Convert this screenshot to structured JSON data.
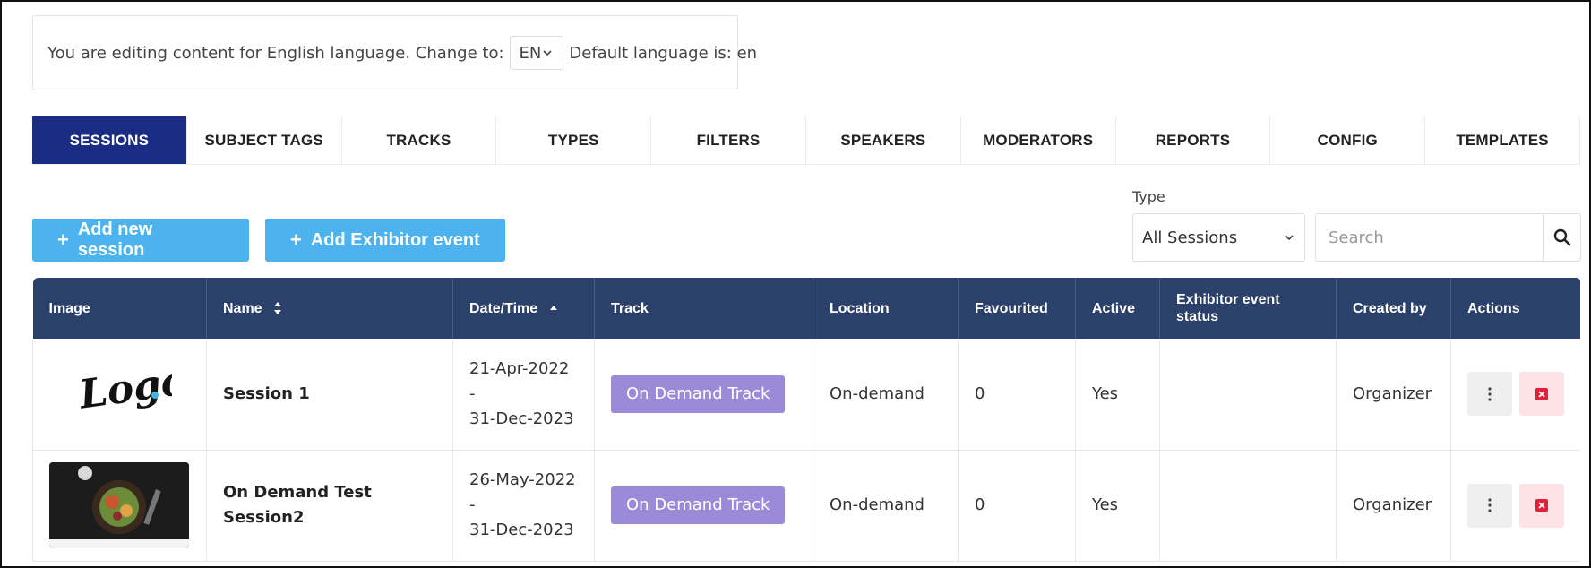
{
  "language_bar": {
    "text_before": "You are editing content for English language. Change to:",
    "selected": "EN",
    "text_after": "Default language is: en"
  },
  "tabs": [
    {
      "label": "SESSIONS",
      "active": true
    },
    {
      "label": "SUBJECT TAGS",
      "active": false
    },
    {
      "label": "TRACKS",
      "active": false
    },
    {
      "label": "TYPES",
      "active": false
    },
    {
      "label": "FILTERS",
      "active": false
    },
    {
      "label": "SPEAKERS",
      "active": false
    },
    {
      "label": "MODERATORS",
      "active": false
    },
    {
      "label": "REPORTS",
      "active": false
    },
    {
      "label": "CONFIG",
      "active": false
    },
    {
      "label": "TEMPLATES",
      "active": false
    }
  ],
  "toolbar": {
    "add_session": "Add new session",
    "add_exhibitor": "Add Exhibitor event",
    "type_label": "Type",
    "type_selected": "All Sessions",
    "search_placeholder": "Search"
  },
  "table": {
    "headers": [
      "Image",
      "Name",
      "Date/Time",
      "Track",
      "Location",
      "Favourited",
      "Active",
      "Exhibitor event status",
      "Created by",
      "Actions"
    ],
    "rows": [
      {
        "image": "logo-image",
        "name": "Session 1",
        "date_start": "21-Apr-2022 -",
        "date_end": "31-Dec-2023",
        "track": "On Demand Track",
        "location": "On-demand",
        "favourited": "0",
        "active": "Yes",
        "exhibitor_status": "",
        "created_by": "Organizer"
      },
      {
        "image": "food-image",
        "name": "On Demand Test Session2",
        "date_start": "26-May-2022 -",
        "date_end": "31-Dec-2023",
        "track": "On Demand Track",
        "location": "On-demand",
        "favourited": "0",
        "active": "Yes",
        "exhibitor_status": "",
        "created_by": "Organizer"
      }
    ]
  },
  "colors": {
    "tab_active": "#1a2c84",
    "header_bg": "#2b406b",
    "add_button": "#4db3ef",
    "track_badge": "#9a8ad8",
    "delete_bg": "#fde3e6",
    "delete_icon": "#e0213a"
  },
  "logo_text": "Logo."
}
